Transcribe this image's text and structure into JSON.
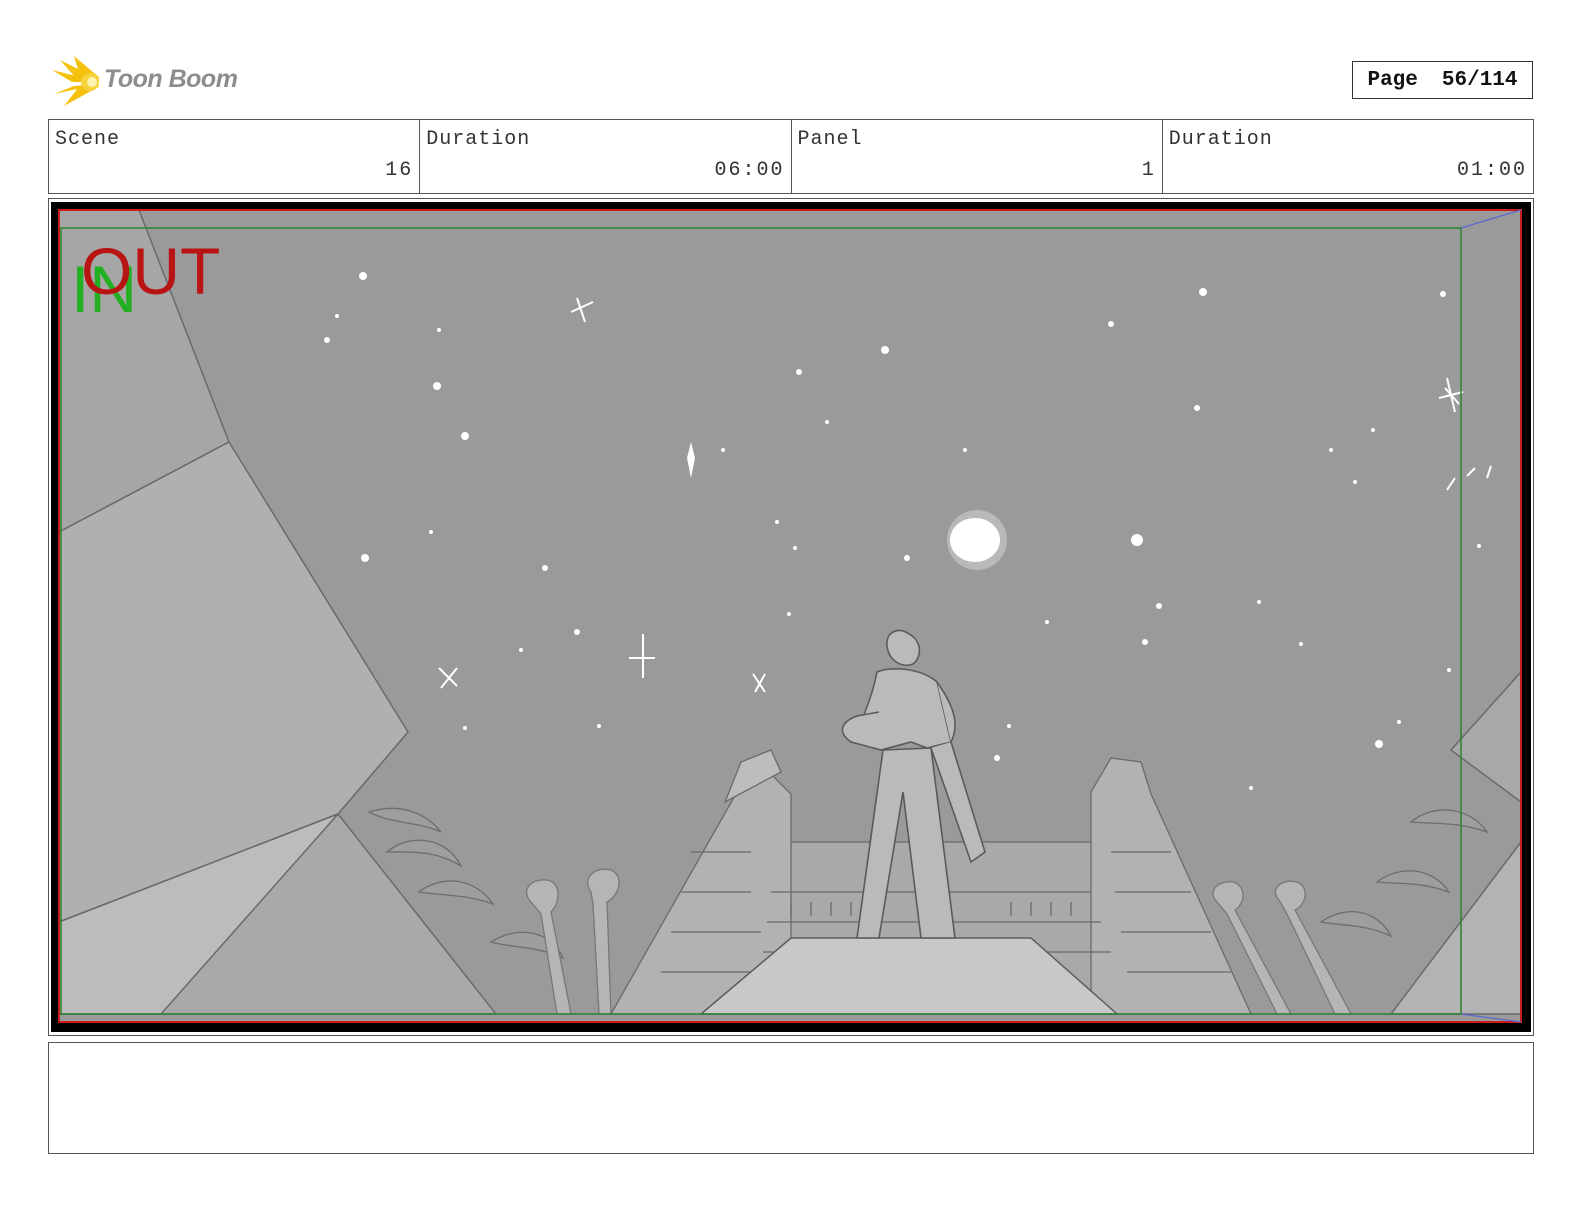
{
  "header": {
    "logo_text": "Toon Boom",
    "page_label": "Page",
    "page_number": "56/114"
  },
  "info": [
    {
      "label": "Scene",
      "value": "16"
    },
    {
      "label": "Duration",
      "value": "06:00"
    },
    {
      "label": "Panel",
      "value": "1"
    },
    {
      "label": "Duration",
      "value": "01:00"
    }
  ],
  "panel": {
    "in_marker": "IN",
    "out_marker": "OUT",
    "colors": {
      "in": "#22b022",
      "out": "#b81414",
      "safe_frame": "#1e7d1e"
    }
  },
  "notes": ""
}
